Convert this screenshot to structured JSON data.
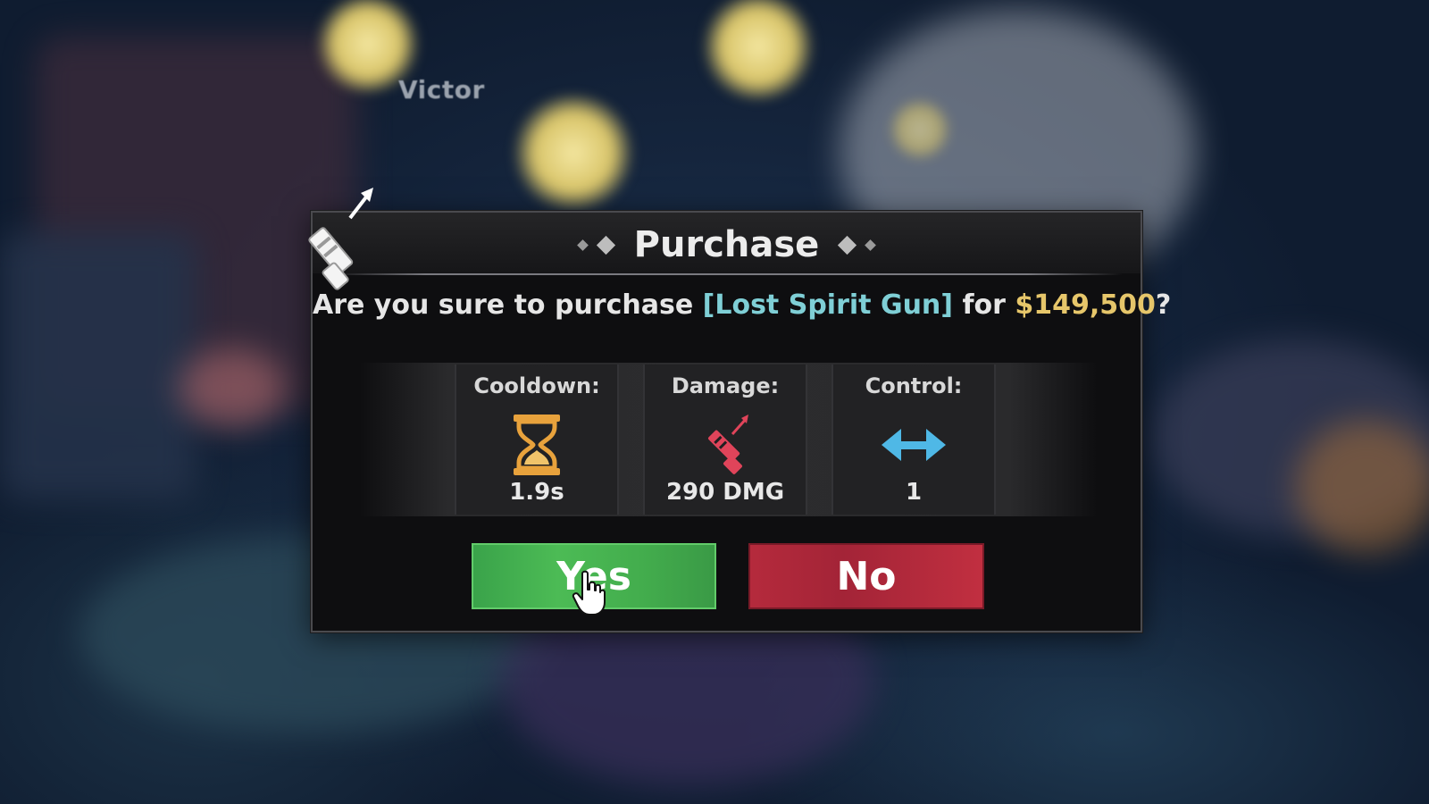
{
  "scene": {
    "npc_name": "Victor"
  },
  "dialog": {
    "title": "Purchase",
    "message_prefix": "Are you sure to purchase ",
    "item_name": "[Lost Spirit Gun]",
    "message_middle": " for ",
    "price": "$149,500",
    "message_suffix": "?",
    "stats": [
      {
        "label": "Cooldown:",
        "value": "1.9s",
        "icon": "hourglass-icon"
      },
      {
        "label": "Damage:",
        "value": "290 DMG",
        "icon": "gun-icon"
      },
      {
        "label": "Control:",
        "value": "1",
        "icon": "double-arrow-icon"
      }
    ],
    "buttons": {
      "yes_label": "Yes",
      "no_label": "No"
    }
  },
  "colors": {
    "item_name": "#7fcfd6",
    "price": "#e6c66a",
    "yes_button": "#43ad4d",
    "no_button": "#b52a3c",
    "cooldown_icon": "#e8a23c",
    "damage_icon": "#e0445a",
    "control_icon": "#4fb8e6"
  }
}
